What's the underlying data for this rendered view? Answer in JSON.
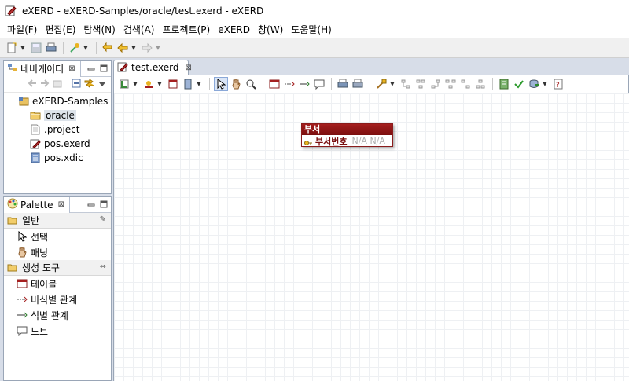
{
  "window": {
    "title": "eXERD - eXERD-Samples/oracle/test.exerd - eXERD"
  },
  "menu": [
    "파일(F)",
    "편집(E)",
    "탐색(N)",
    "검색(A)",
    "프로젝트(P)",
    "eXERD",
    "창(W)",
    "도움말(H)"
  ],
  "navigator": {
    "tab_label": "네비게이터",
    "tree": [
      {
        "label": "eXERD-Samples",
        "icon": "project-icon",
        "level": 0
      },
      {
        "label": "oracle",
        "icon": "folder-icon",
        "level": 1,
        "selected": true
      },
      {
        "label": ".project",
        "icon": "file-icon",
        "level": 1
      },
      {
        "label": "pos.exerd",
        "icon": "exerd-file-icon",
        "level": 1
      },
      {
        "label": "pos.xdic",
        "icon": "xdic-file-icon",
        "level": 1
      }
    ]
  },
  "palette": {
    "tab_label": "Palette",
    "groups": [
      {
        "label": "일반",
        "items": [
          {
            "label": "선택",
            "icon": "arrow-select-icon"
          },
          {
            "label": "패닝",
            "icon": "hand-pan-icon"
          }
        ]
      },
      {
        "label": "생성 도구",
        "items": [
          {
            "label": "테이블",
            "icon": "table-icon"
          },
          {
            "label": "비식별 관계",
            "icon": "non-identifying-relation-icon"
          },
          {
            "label": "식별 관계",
            "icon": "identifying-relation-icon"
          },
          {
            "label": "노트",
            "icon": "note-icon"
          }
        ]
      }
    ]
  },
  "editor": {
    "tab_label": "test.exerd",
    "entity": {
      "name": "부서",
      "columns": [
        {
          "name": "부서번호",
          "type": "N/A N/A",
          "primary_key": true
        }
      ]
    }
  },
  "colors": {
    "entity_header": "#8a1c1c",
    "selection": "#dde3ea",
    "frame": "#9aa6b7"
  }
}
